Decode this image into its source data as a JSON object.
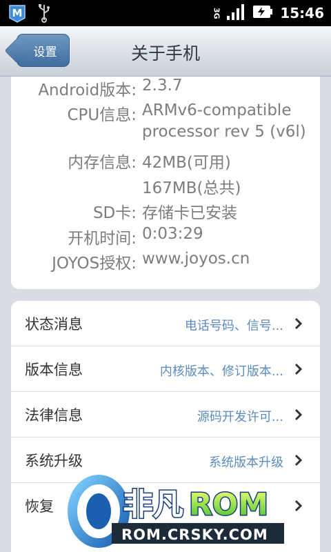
{
  "status_bar": {
    "time": "15:46",
    "network": "3G",
    "icons": [
      "app-m-icon",
      "usb-icon",
      "signal-icon",
      "battery-charging-icon"
    ]
  },
  "header": {
    "back_label": "设置",
    "title": "关于手机"
  },
  "info": {
    "android_label": "Android版本:",
    "android_value": "2.3.7",
    "cpu_label": "CPU信息:",
    "cpu_value_1": "ARMv6-compatible",
    "cpu_value_2": "processor rev 5 (v6l)",
    "memory_label": "内存信息:",
    "memory_value_1": "42MB(可用)",
    "memory_value_2": "167MB(总共)",
    "sd_label": "SD卡:",
    "sd_value": "存储卡已安装",
    "uptime_label": "开机时间:",
    "uptime_value": "0:03:29",
    "joyos_label": "JOYOS授权:",
    "joyos_value": "www.joyos.cn"
  },
  "list": [
    {
      "title": "状态消息",
      "sub": "电话号码、信号..."
    },
    {
      "title": "版本信息",
      "sub": "内核版本、修订版本..."
    },
    {
      "title": "法律信息",
      "sub": "源码开发许可..."
    },
    {
      "title": "系统升级",
      "sub": "系统版本升级"
    },
    {
      "title": "恢复",
      "sub": ""
    }
  ],
  "watermark": {
    "brand": "非凡ROM",
    "url": "ROM.CRSKY.COM"
  },
  "colors": {
    "accent": "#5a8cbf",
    "label_gray": "#7d7d7d",
    "back_button": "#4b79a8"
  }
}
